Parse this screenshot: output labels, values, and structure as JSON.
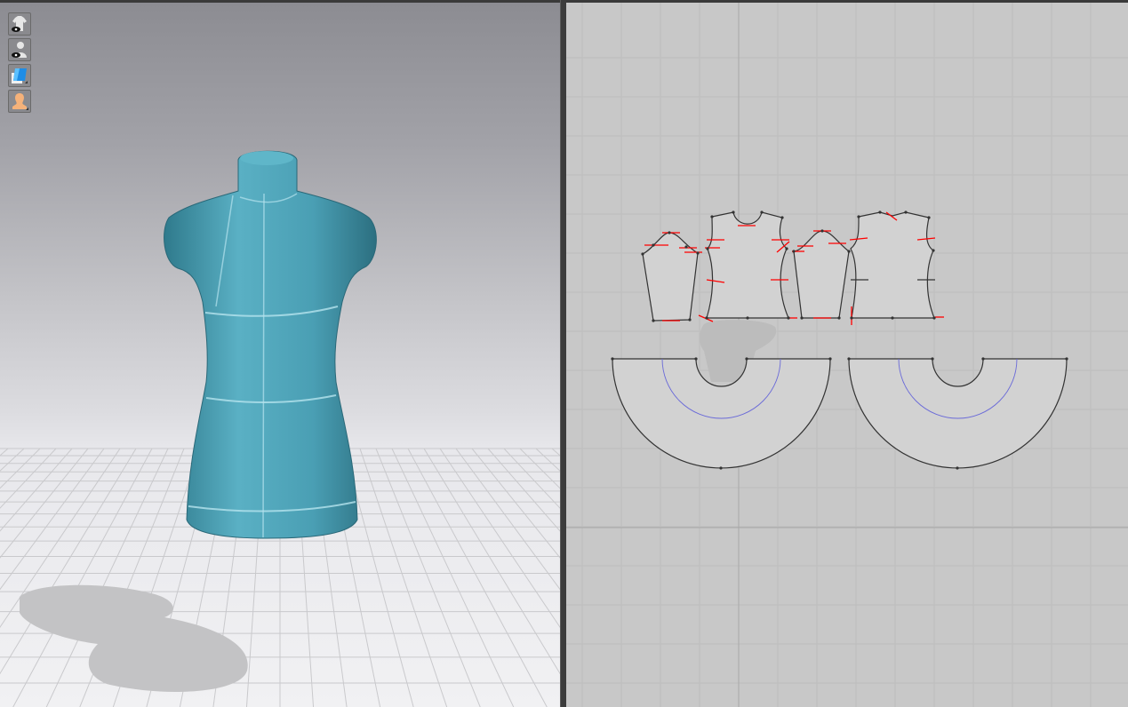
{
  "viewport_3d": {
    "toolbar": [
      {
        "icon": "show-garment-icon"
      },
      {
        "icon": "show-avatar-icon"
      },
      {
        "icon": "texture-display-icon"
      },
      {
        "icon": "avatar-display-icon"
      }
    ],
    "avatar_color": "#4fa3b8"
  },
  "viewport_2d": {
    "pieces": [
      "sleeve-front",
      "bodice-front",
      "sleeve-back",
      "bodice-back",
      "skirt-front",
      "skirt-back"
    ],
    "notch_color": "#ff0000",
    "internal_line_color": "#5a5ad0"
  }
}
